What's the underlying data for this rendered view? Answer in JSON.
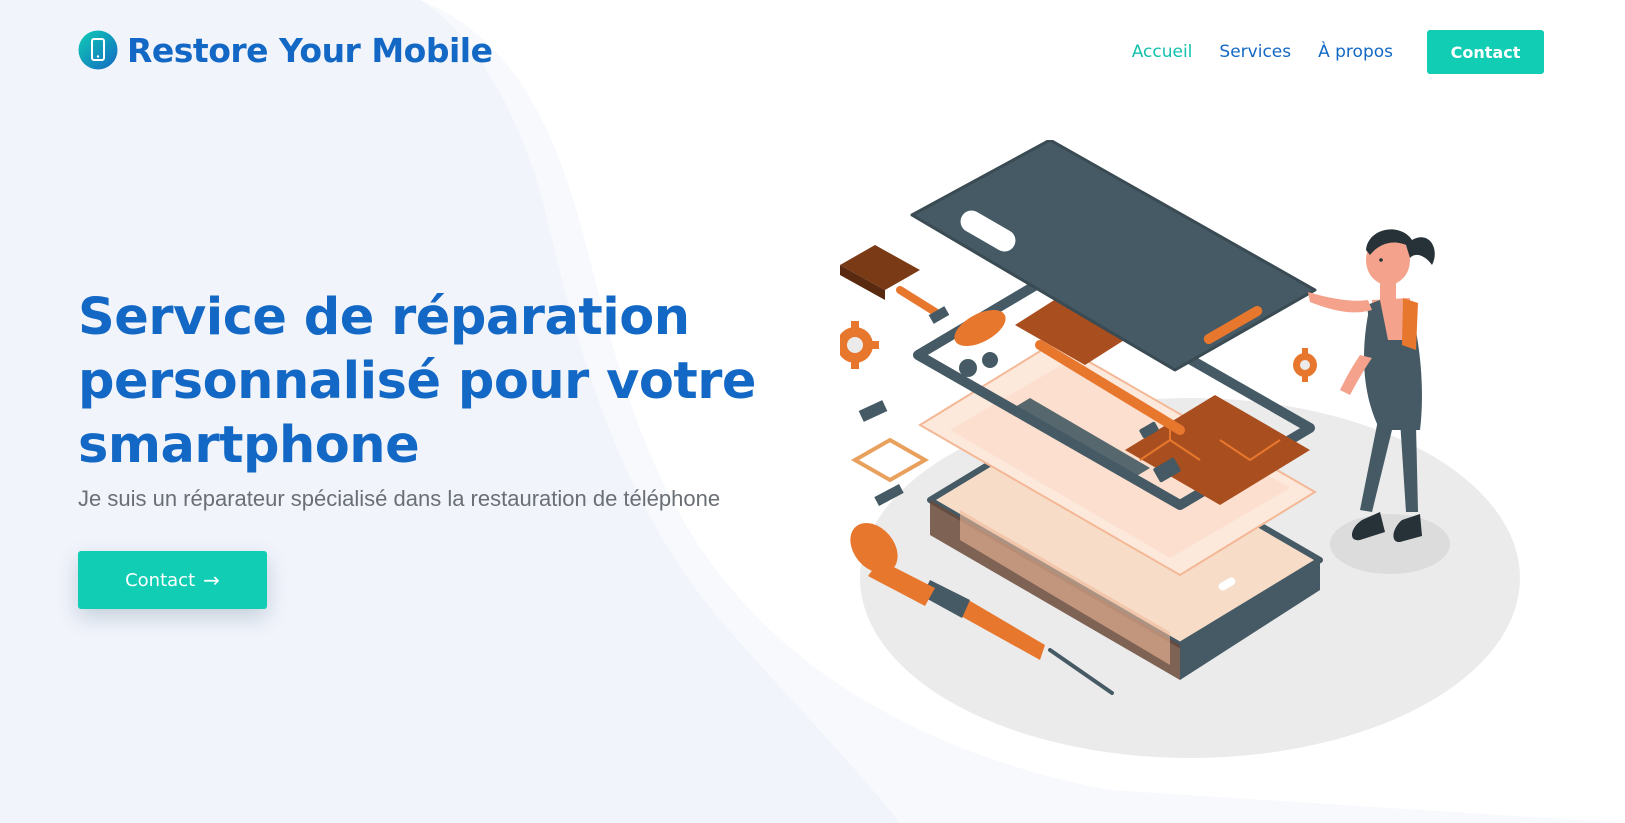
{
  "brand": {
    "name": "Restore Your Mobile",
    "logo_icon": "smartphone-icon"
  },
  "nav": {
    "items": [
      {
        "label": "Accueil",
        "active": true
      },
      {
        "label": "Services",
        "active": false
      },
      {
        "label": "À propos",
        "active": false
      }
    ],
    "cta_label": "Contact"
  },
  "hero": {
    "title": "Service de réparation personnalisé pour votre smartphone",
    "subtitle": "Je suis un réparateur spécialisé dans la restauration de téléphone",
    "cta_label": "Contact",
    "cta_icon": "arrow-right-icon"
  },
  "colors": {
    "primary_blue": "#1268c4",
    "accent_teal": "#10cdb3",
    "hero_bg": "#f1f4fb",
    "text_gray": "#6a6f76",
    "illustration_orange": "#e8772e",
    "illustration_slate": "#455a64"
  }
}
